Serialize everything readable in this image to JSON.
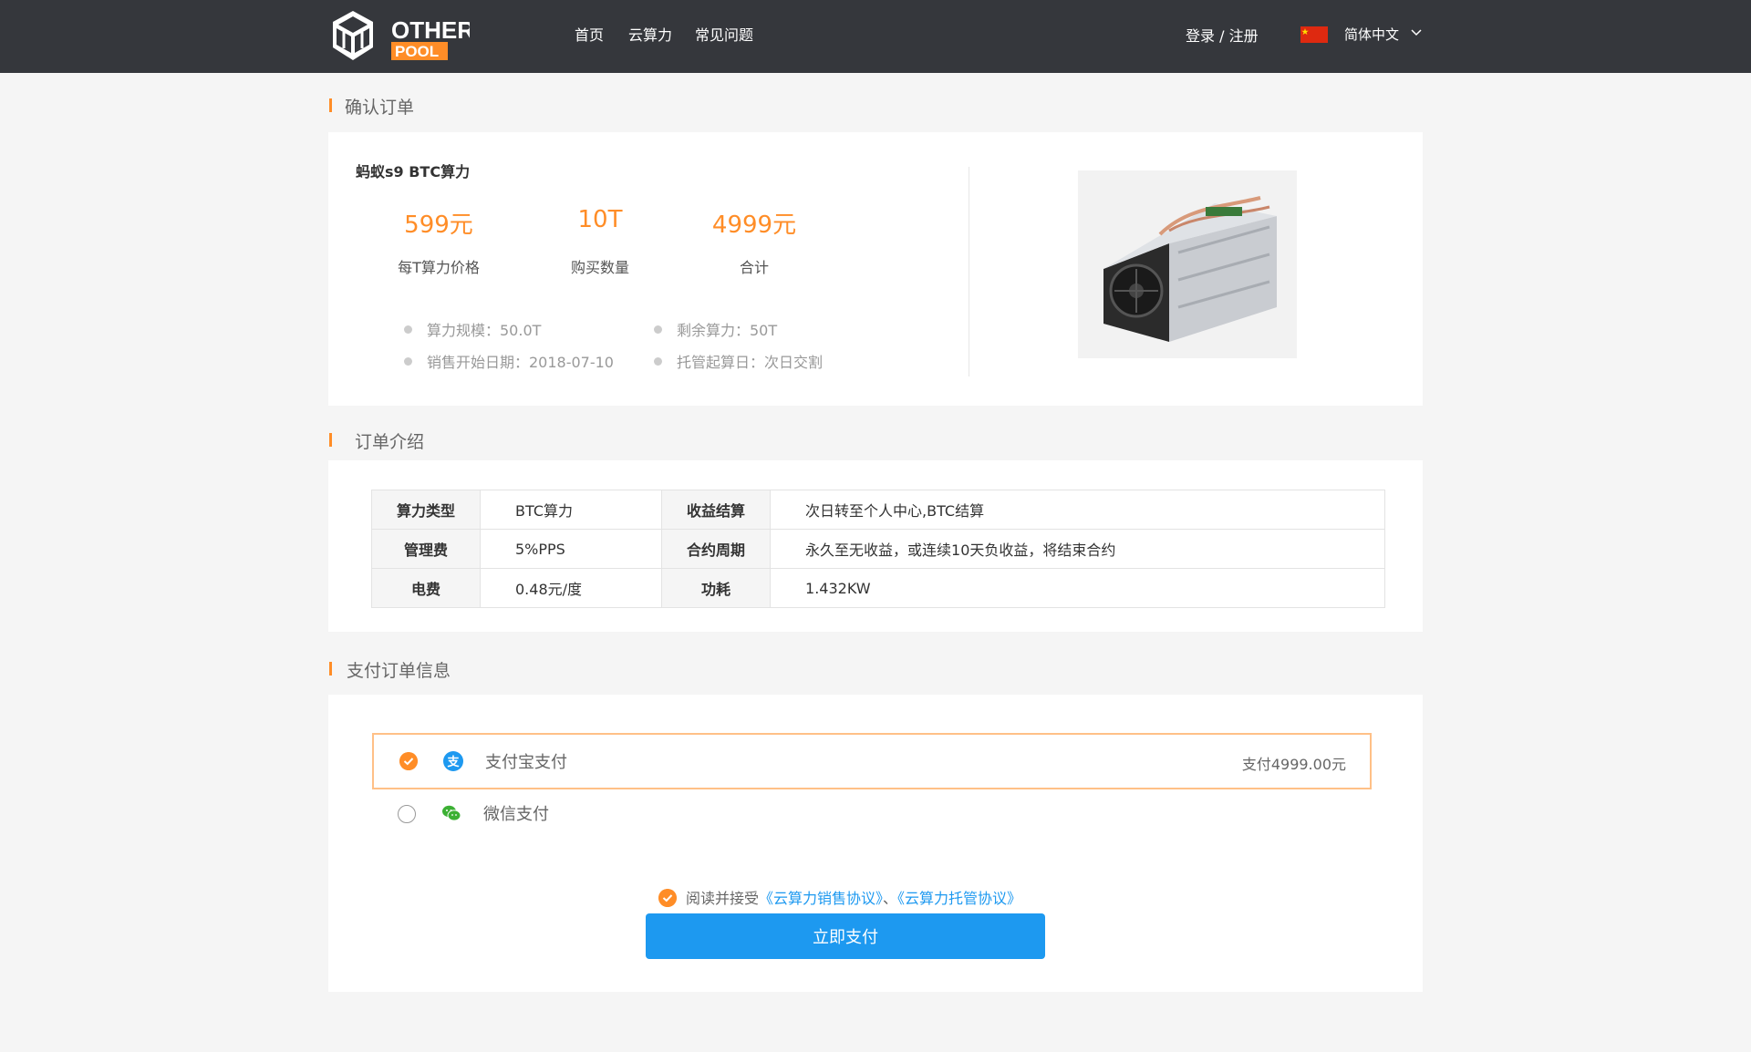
{
  "header": {
    "logo_text": "OTHER POOL",
    "nav": [
      "首页",
      "云算力",
      "常见问题"
    ],
    "login_label": "登录 / 注册",
    "language": "简体中文"
  },
  "confirm": {
    "title": "确认订单",
    "product_name": "蚂蚁s9  BTC算力",
    "price": "599元",
    "price_label": "每T算力价格",
    "quantity": "10T",
    "quantity_label": "购买数量",
    "total": "4999元",
    "total_label": "合计",
    "info": [
      "算力规模：50.0T",
      "剩余算力：50T",
      "销售开始日期：2018-07-10",
      "托管起算日：次日交割"
    ]
  },
  "intro": {
    "title": "订单介绍",
    "rows": [
      [
        "算力类型",
        "BTC算力",
        "收益结算",
        "次日转至个人中心,BTC结算"
      ],
      [
        "管理费",
        "5%PPS",
        "合约周期",
        "永久至无收益，或连续10天负收益，将结束合约"
      ],
      [
        "电费",
        "0.48元/度",
        "功耗",
        "1.432KW"
      ]
    ]
  },
  "payment": {
    "title": "支付订单信息",
    "methods": [
      {
        "name": "支付宝支付",
        "amount": "支付4999.00元",
        "selected": true
      },
      {
        "name": "微信支付",
        "selected": false
      }
    ],
    "agree_prefix": "阅读并接受",
    "agree_link1": "《云算力销售协议》",
    "agree_sep": "、",
    "agree_link2": "《云算力托管协议》",
    "submit_label": "立即支付"
  },
  "colors": {
    "accent": "#ff8d27",
    "link": "#1d99f0",
    "header_bg": "#35373c"
  }
}
